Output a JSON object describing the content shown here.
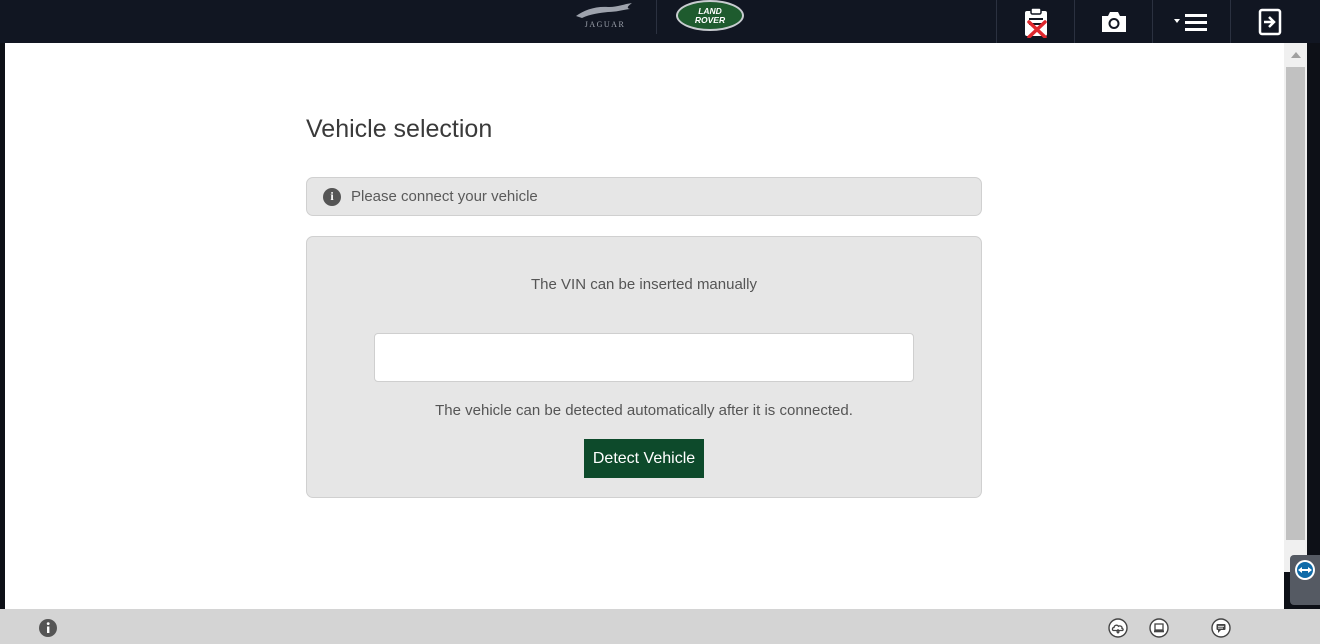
{
  "topbar": {
    "brand_jaguar": "JAGUAR",
    "brand_landrover_line1": "LAND",
    "brand_landrover_line2": "ROVER",
    "tools": [
      {
        "name": "clipboard-cancel-icon"
      },
      {
        "name": "camera-icon"
      },
      {
        "name": "menu-icon"
      },
      {
        "name": "logout-icon"
      }
    ]
  },
  "page": {
    "title": "Vehicle selection"
  },
  "banner": {
    "icon": "info-icon",
    "message": "Please connect your vehicle"
  },
  "vin_panel": {
    "hint": "The VIN can be inserted manually",
    "vin_value": "",
    "auto_hint": "The vehicle can be detected automatically after it is connected.",
    "detect_label": "Detect Vehicle"
  },
  "bottombar": {
    "icons": [
      "info-icon",
      "cloud-icon",
      "laptop-icon",
      "chat-icon"
    ]
  },
  "colors": {
    "topbar": "#111622",
    "accent_green": "#0d4a2b",
    "panel_bg": "#e6e6e6",
    "landrover_green": "#1e5b2e"
  }
}
